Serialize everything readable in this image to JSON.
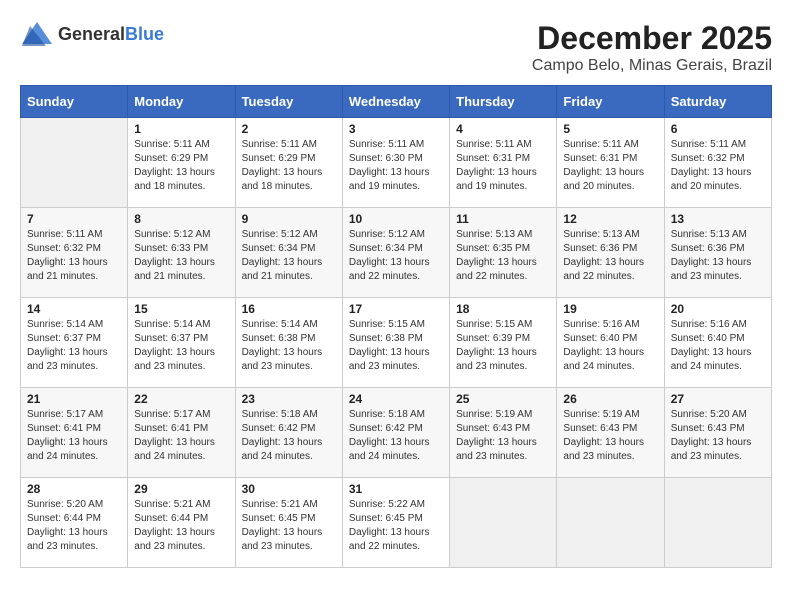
{
  "logo": {
    "text_general": "General",
    "text_blue": "Blue"
  },
  "title": {
    "month_year": "December 2025",
    "location": "Campo Belo, Minas Gerais, Brazil"
  },
  "header": {
    "days": [
      "Sunday",
      "Monday",
      "Tuesday",
      "Wednesday",
      "Thursday",
      "Friday",
      "Saturday"
    ]
  },
  "weeks": [
    {
      "cells": [
        {
          "day": null,
          "empty": true
        },
        {
          "day": "1",
          "sunrise": "Sunrise: 5:11 AM",
          "sunset": "Sunset: 6:29 PM",
          "daylight": "Daylight: 13 hours and 18 minutes."
        },
        {
          "day": "2",
          "sunrise": "Sunrise: 5:11 AM",
          "sunset": "Sunset: 6:29 PM",
          "daylight": "Daylight: 13 hours and 18 minutes."
        },
        {
          "day": "3",
          "sunrise": "Sunrise: 5:11 AM",
          "sunset": "Sunset: 6:30 PM",
          "daylight": "Daylight: 13 hours and 19 minutes."
        },
        {
          "day": "4",
          "sunrise": "Sunrise: 5:11 AM",
          "sunset": "Sunset: 6:31 PM",
          "daylight": "Daylight: 13 hours and 19 minutes."
        },
        {
          "day": "5",
          "sunrise": "Sunrise: 5:11 AM",
          "sunset": "Sunset: 6:31 PM",
          "daylight": "Daylight: 13 hours and 20 minutes."
        },
        {
          "day": "6",
          "sunrise": "Sunrise: 5:11 AM",
          "sunset": "Sunset: 6:32 PM",
          "daylight": "Daylight: 13 hours and 20 minutes."
        }
      ]
    },
    {
      "cells": [
        {
          "day": "7",
          "sunrise": "Sunrise: 5:11 AM",
          "sunset": "Sunset: 6:32 PM",
          "daylight": "Daylight: 13 hours and 21 minutes."
        },
        {
          "day": "8",
          "sunrise": "Sunrise: 5:12 AM",
          "sunset": "Sunset: 6:33 PM",
          "daylight": "Daylight: 13 hours and 21 minutes."
        },
        {
          "day": "9",
          "sunrise": "Sunrise: 5:12 AM",
          "sunset": "Sunset: 6:34 PM",
          "daylight": "Daylight: 13 hours and 21 minutes."
        },
        {
          "day": "10",
          "sunrise": "Sunrise: 5:12 AM",
          "sunset": "Sunset: 6:34 PM",
          "daylight": "Daylight: 13 hours and 22 minutes."
        },
        {
          "day": "11",
          "sunrise": "Sunrise: 5:13 AM",
          "sunset": "Sunset: 6:35 PM",
          "daylight": "Daylight: 13 hours and 22 minutes."
        },
        {
          "day": "12",
          "sunrise": "Sunrise: 5:13 AM",
          "sunset": "Sunset: 6:36 PM",
          "daylight": "Daylight: 13 hours and 22 minutes."
        },
        {
          "day": "13",
          "sunrise": "Sunrise: 5:13 AM",
          "sunset": "Sunset: 6:36 PM",
          "daylight": "Daylight: 13 hours and 23 minutes."
        }
      ]
    },
    {
      "cells": [
        {
          "day": "14",
          "sunrise": "Sunrise: 5:14 AM",
          "sunset": "Sunset: 6:37 PM",
          "daylight": "Daylight: 13 hours and 23 minutes."
        },
        {
          "day": "15",
          "sunrise": "Sunrise: 5:14 AM",
          "sunset": "Sunset: 6:37 PM",
          "daylight": "Daylight: 13 hours and 23 minutes."
        },
        {
          "day": "16",
          "sunrise": "Sunrise: 5:14 AM",
          "sunset": "Sunset: 6:38 PM",
          "daylight": "Daylight: 13 hours and 23 minutes."
        },
        {
          "day": "17",
          "sunrise": "Sunrise: 5:15 AM",
          "sunset": "Sunset: 6:38 PM",
          "daylight": "Daylight: 13 hours and 23 minutes."
        },
        {
          "day": "18",
          "sunrise": "Sunrise: 5:15 AM",
          "sunset": "Sunset: 6:39 PM",
          "daylight": "Daylight: 13 hours and 23 minutes."
        },
        {
          "day": "19",
          "sunrise": "Sunrise: 5:16 AM",
          "sunset": "Sunset: 6:40 PM",
          "daylight": "Daylight: 13 hours and 24 minutes."
        },
        {
          "day": "20",
          "sunrise": "Sunrise: 5:16 AM",
          "sunset": "Sunset: 6:40 PM",
          "daylight": "Daylight: 13 hours and 24 minutes."
        }
      ]
    },
    {
      "cells": [
        {
          "day": "21",
          "sunrise": "Sunrise: 5:17 AM",
          "sunset": "Sunset: 6:41 PM",
          "daylight": "Daylight: 13 hours and 24 minutes."
        },
        {
          "day": "22",
          "sunrise": "Sunrise: 5:17 AM",
          "sunset": "Sunset: 6:41 PM",
          "daylight": "Daylight: 13 hours and 24 minutes."
        },
        {
          "day": "23",
          "sunrise": "Sunrise: 5:18 AM",
          "sunset": "Sunset: 6:42 PM",
          "daylight": "Daylight: 13 hours and 24 minutes."
        },
        {
          "day": "24",
          "sunrise": "Sunrise: 5:18 AM",
          "sunset": "Sunset: 6:42 PM",
          "daylight": "Daylight: 13 hours and 24 minutes."
        },
        {
          "day": "25",
          "sunrise": "Sunrise: 5:19 AM",
          "sunset": "Sunset: 6:43 PM",
          "daylight": "Daylight: 13 hours and 23 minutes."
        },
        {
          "day": "26",
          "sunrise": "Sunrise: 5:19 AM",
          "sunset": "Sunset: 6:43 PM",
          "daylight": "Daylight: 13 hours and 23 minutes."
        },
        {
          "day": "27",
          "sunrise": "Sunrise: 5:20 AM",
          "sunset": "Sunset: 6:43 PM",
          "daylight": "Daylight: 13 hours and 23 minutes."
        }
      ]
    },
    {
      "cells": [
        {
          "day": "28",
          "sunrise": "Sunrise: 5:20 AM",
          "sunset": "Sunset: 6:44 PM",
          "daylight": "Daylight: 13 hours and 23 minutes."
        },
        {
          "day": "29",
          "sunrise": "Sunrise: 5:21 AM",
          "sunset": "Sunset: 6:44 PM",
          "daylight": "Daylight: 13 hours and 23 minutes."
        },
        {
          "day": "30",
          "sunrise": "Sunrise: 5:21 AM",
          "sunset": "Sunset: 6:45 PM",
          "daylight": "Daylight: 13 hours and 23 minutes."
        },
        {
          "day": "31",
          "sunrise": "Sunrise: 5:22 AM",
          "sunset": "Sunset: 6:45 PM",
          "daylight": "Daylight: 13 hours and 22 minutes."
        },
        {
          "day": null,
          "empty": true
        },
        {
          "day": null,
          "empty": true
        },
        {
          "day": null,
          "empty": true
        }
      ]
    }
  ]
}
